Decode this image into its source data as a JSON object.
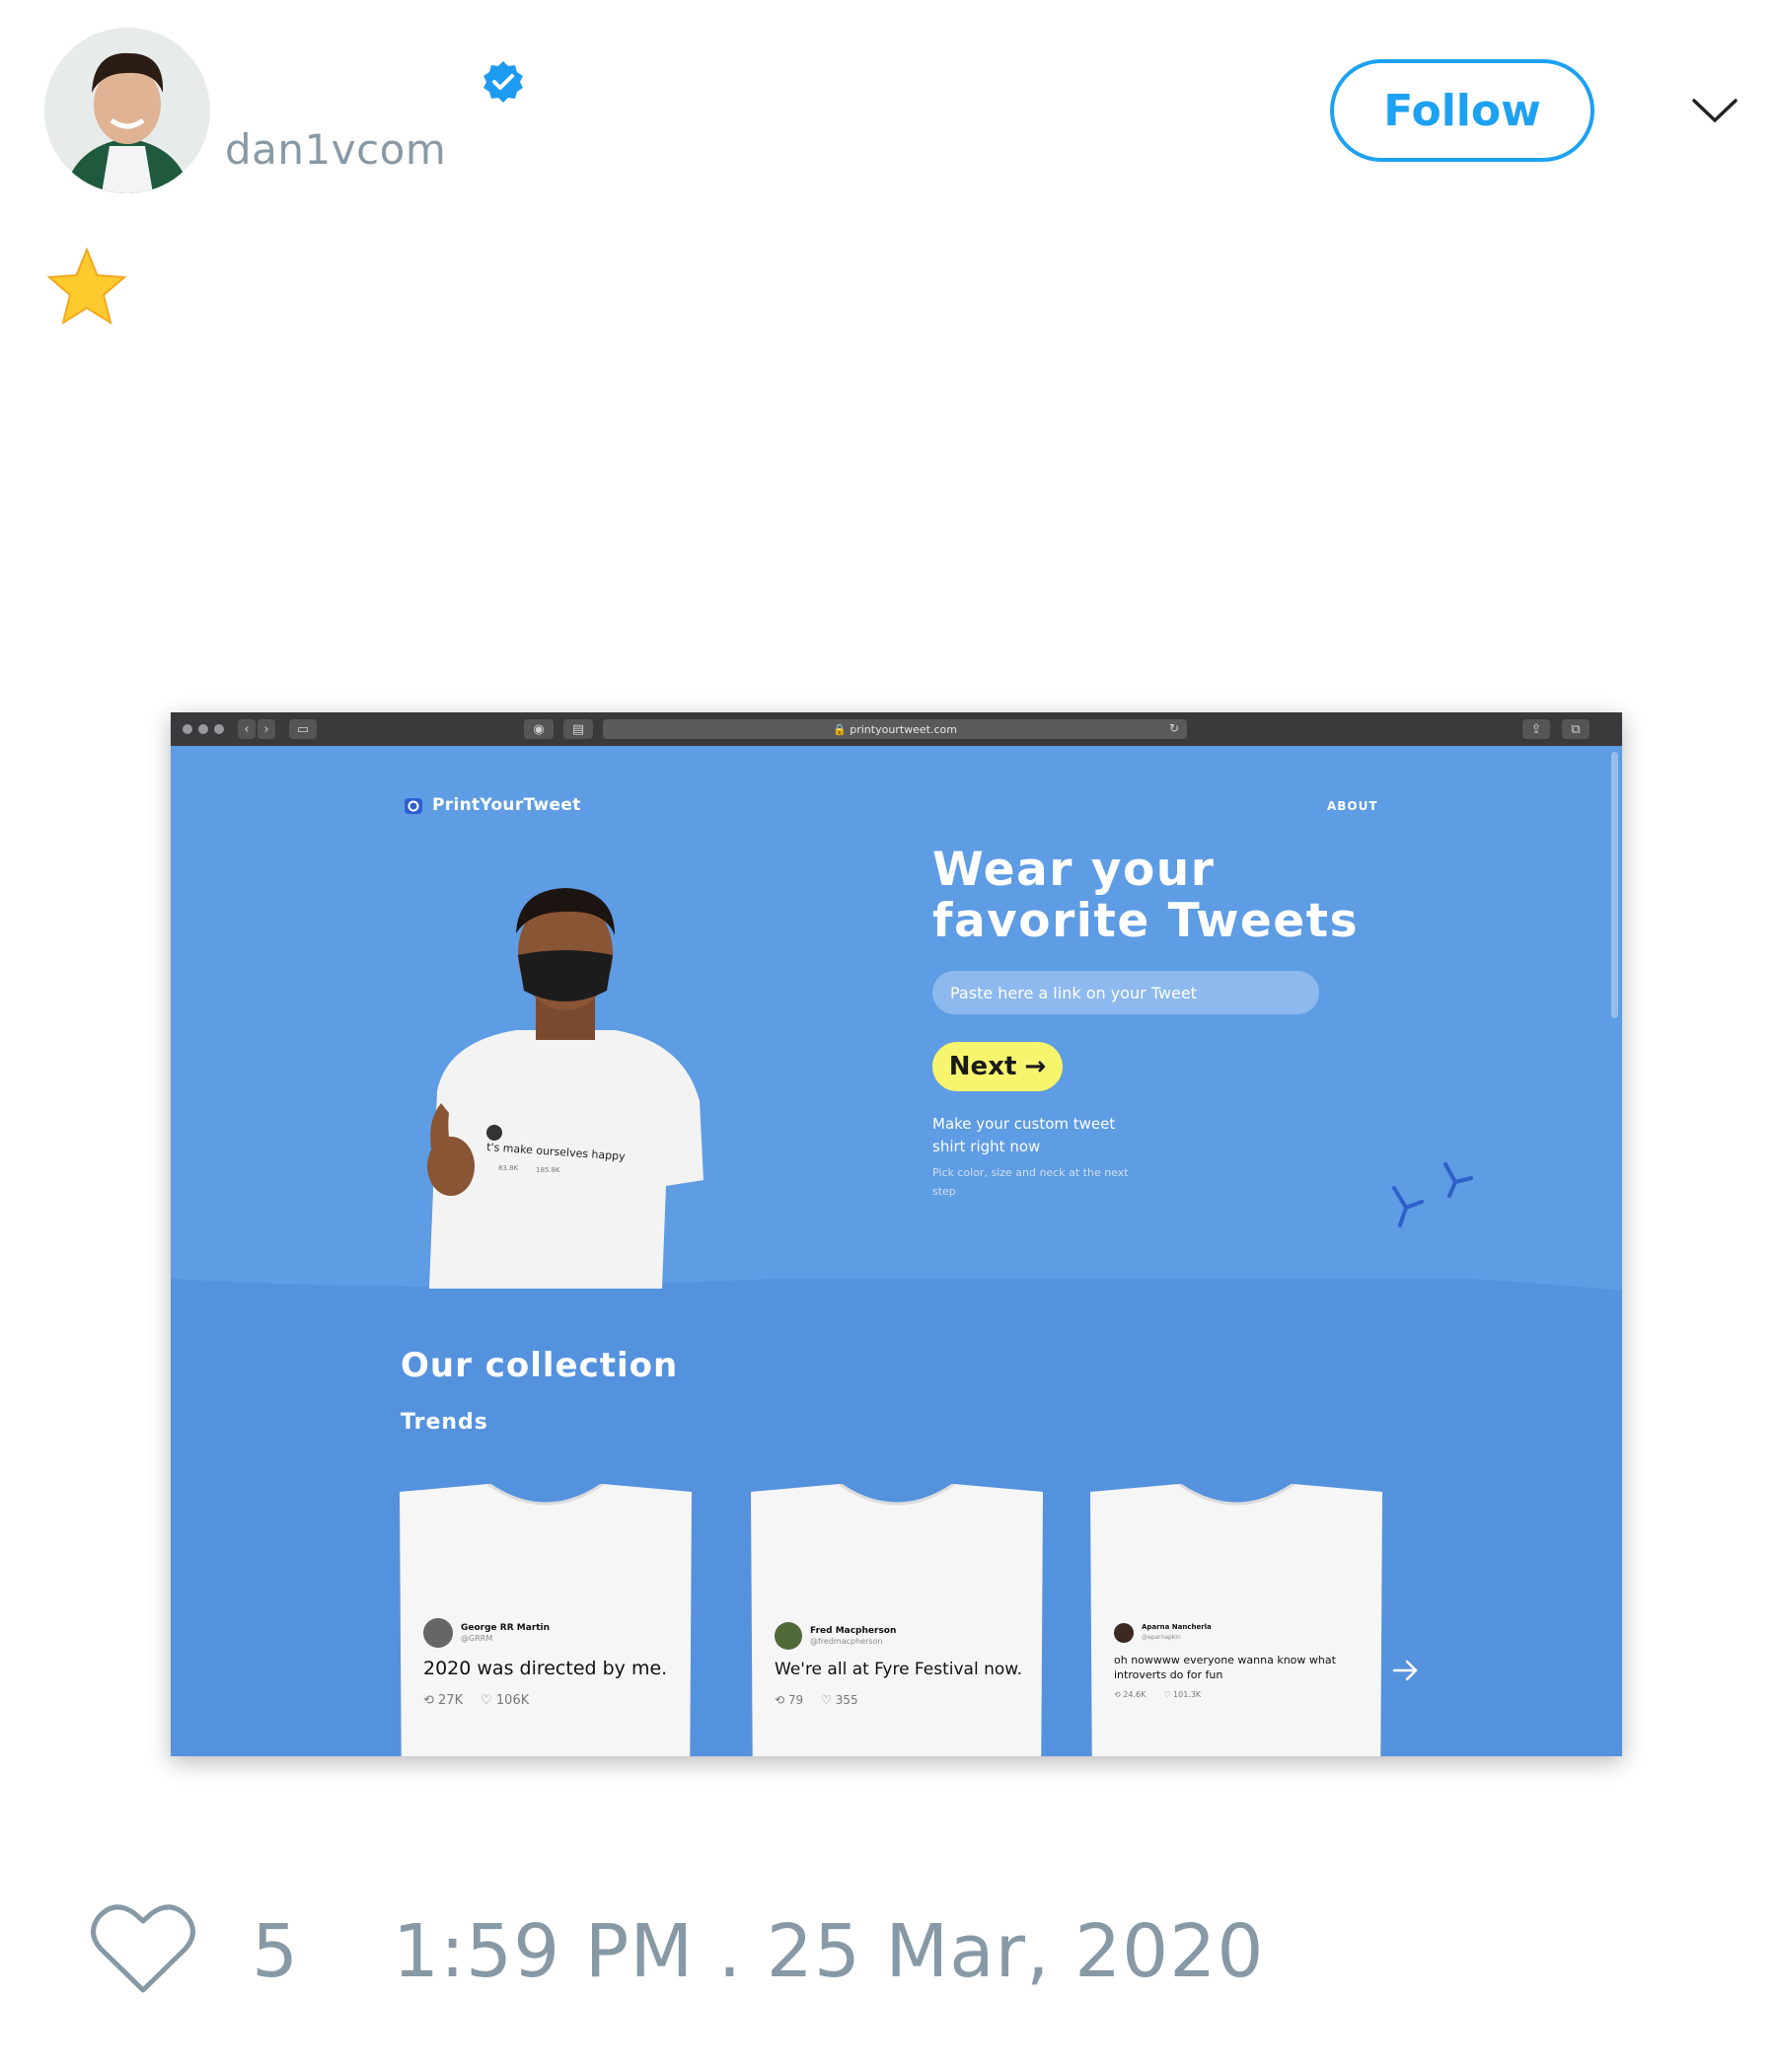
{
  "tweet": {
    "author": {
      "handle": "dan1vcom",
      "verified": true,
      "avatar_icon": "profile-photo"
    },
    "follow_label": "Follow",
    "menu_icon": "chevron-down-icon",
    "text_emoji": "star-emoji",
    "likes": "5",
    "timestamp": "1:59 PM . 25 Mar, 2020",
    "accent_color": "#1da1f2",
    "muted_color": "#8899a6"
  },
  "screenshot": {
    "browser": {
      "url": "printyourtweet.com"
    },
    "site": {
      "logo_text": "PrintYourTweet",
      "nav_about": "ABOUT",
      "headline_line1": "Wear your",
      "headline_line2": "favorite Tweets",
      "input_placeholder": "Paste here a link on your Tweet",
      "next_label": "Next",
      "cta_text": "Make your custom tweet shirt right now",
      "cta_subtext": "Pick color, size and neck at the next step",
      "model_shirt_text": "t's make ourselves happy",
      "model_shirt_stats": [
        "83.8K",
        "185.8K"
      ],
      "collection_title": "Our collection",
      "trends_label": "Trends",
      "bg_color": "#5e9ce3",
      "button_color": "#f7f56e"
    },
    "products": [
      {
        "name": "George RR Martin",
        "user": "@GRRM",
        "text": "2020 was directed by me.",
        "retweets": "27K",
        "likes": "106K"
      },
      {
        "name": "Fred Macpherson",
        "user": "@fredmacpherson",
        "text": "We're all at Fyre Festival now.",
        "retweets": "79",
        "likes": "355"
      },
      {
        "name": "Aparna Nancherla",
        "user": "@aparnapkin",
        "text": "oh nowwww everyone wanna know what introverts do for fun",
        "retweets": "24.6K",
        "likes": "101.3K"
      }
    ]
  }
}
